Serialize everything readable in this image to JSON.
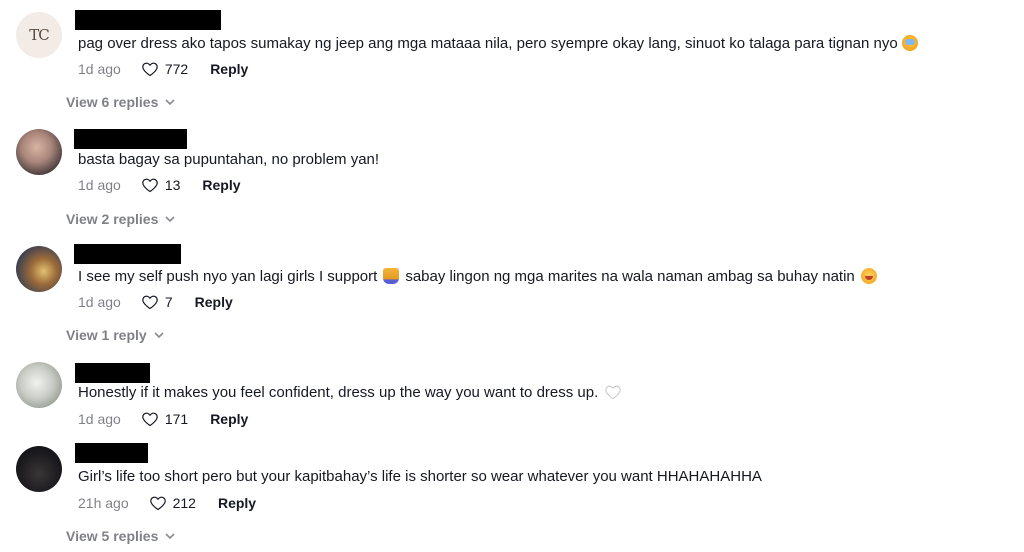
{
  "comments": [
    {
      "avatar_text": "TC",
      "text": "pag over dress ako tapos sumakay ng jeep ang mga mataaa nila, pero syempre okay lang, sinuot ko talaga para tignan nyo",
      "emoji": "crying-face-icon",
      "time": "1d ago",
      "likes": "772",
      "reply_label": "Reply",
      "view_replies": "View 6 replies"
    },
    {
      "text": "basta bagay sa pupuntahan, no problem yan!",
      "time": "1d ago",
      "likes": "13",
      "reply_label": "Reply",
      "view_replies": "View 2 replies"
    },
    {
      "text_a": "I see my self push nyo yan lagi girls I support",
      "text_b": "sabay lingon ng mga marites na wala naman ambag sa buhay natin",
      "time": "1d ago",
      "likes": "7",
      "reply_label": "Reply",
      "view_replies": "View 1 reply"
    },
    {
      "text": "Honestly if it makes you feel confident, dress up the way you want to dress up.",
      "time": "1d ago",
      "likes": "171",
      "reply_label": "Reply"
    },
    {
      "text": "Girl’s life too short pero but your kapitbahay’s life is shorter so wear whatever you want HHAHAHAHHA",
      "time": "21h ago",
      "likes": "212",
      "reply_label": "Reply",
      "view_replies": "View 5 replies"
    }
  ],
  "colors": {
    "text": "#161823",
    "muted": "#8a8b91",
    "redaction": "#000000"
  }
}
